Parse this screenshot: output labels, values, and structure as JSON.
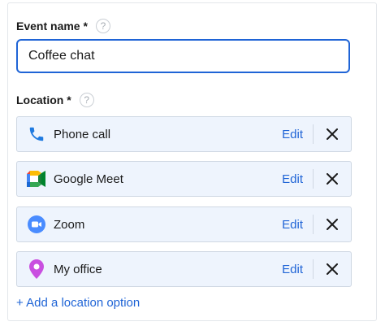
{
  "event_name": {
    "label": "Event name *",
    "help": "?",
    "value": "Coffee chat"
  },
  "location": {
    "label": "Location *",
    "help": "?",
    "items": [
      {
        "label": "Phone call",
        "icon": "phone-icon",
        "edit": "Edit"
      },
      {
        "label": "Google Meet",
        "icon": "google-meet-icon",
        "edit": "Edit"
      },
      {
        "label": "Zoom",
        "icon": "zoom-icon",
        "edit": "Edit"
      },
      {
        "label": "My office",
        "icon": "map-pin-icon",
        "edit": "Edit"
      }
    ]
  },
  "add_location": "+ Add a location option",
  "colors": {
    "accent": "#1f64d6",
    "row_bg": "#eef4fd",
    "phone": "#1f7ae0",
    "zoom": "#4a8cff",
    "pin": "#c94fe0"
  }
}
